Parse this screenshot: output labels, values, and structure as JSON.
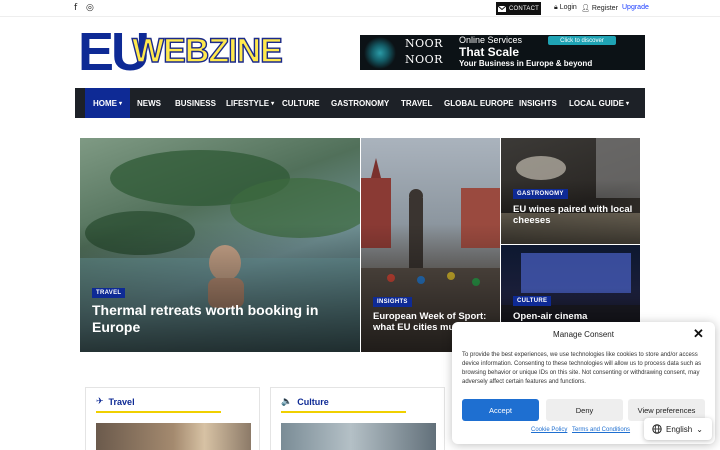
{
  "topbar": {
    "facebook_glyph": "f",
    "instagram_glyph": "◎",
    "contact_label": "CONTACT",
    "login_label": "Login",
    "register_label": "Register",
    "upgrade_label": "Upgrade"
  },
  "logo": {
    "part1": "EU",
    "part2": "WEBZINE"
  },
  "ad": {
    "brand_line1": "NOOR",
    "brand_line2": "NOOR",
    "line1": "Online Services",
    "line2": "That Scale",
    "line3": "Your Business in Europe & beyond",
    "cta": "Click to discover"
  },
  "nav": {
    "items": [
      {
        "label": "HOME",
        "caret": "▾"
      },
      {
        "label": "NEWS"
      },
      {
        "label": "BUSINESS"
      },
      {
        "label": "LIFESTYLE",
        "caret": "▾"
      },
      {
        "label": "CULTURE"
      },
      {
        "label": "GASTRONOMY"
      },
      {
        "label": "TRAVEL"
      },
      {
        "label": "GLOBAL EUROPE"
      },
      {
        "label": "INSIGHTS"
      },
      {
        "label": "LOCAL GUIDE",
        "caret": "▾"
      }
    ]
  },
  "hero": {
    "main": {
      "category": "TRAVEL",
      "title": "Thermal retreats worth booking in Europe"
    },
    "middle": {
      "category": "INSIGHTS",
      "title": "European Week of Sport: what EU cities mu"
    },
    "top_right": {
      "category": "GASTRONOMY",
      "title": "EU wines paired with local cheeses"
    },
    "bottom_right": {
      "category": "CULTURE",
      "title": "Open-air cinema"
    }
  },
  "cards": [
    {
      "title": "Travel",
      "icon": "✈"
    },
    {
      "title": "Culture",
      "icon": "🔈"
    }
  ],
  "consent": {
    "title": "Manage Consent",
    "close": "✕",
    "body": "To provide the best experiences, we use technologies like cookies to store and/or access device information. Consenting to these technologies will allow us to process data such as browsing behavior or unique IDs on this site. Not consenting or withdrawing consent, may adversely affect certain features and functions.",
    "accept": "Accept",
    "deny": "Deny",
    "preferences": "View preferences",
    "cookie_policy": "Cookie Policy",
    "terms": "Terms and Conditions"
  },
  "language": {
    "label": "English",
    "icon": "globe-icon",
    "caret": "⌄"
  },
  "colors": {
    "brand_blue": "#0e2a95",
    "accent_yellow": "#f0d000",
    "nav_bg": "#1d2127",
    "accept_blue": "#1e6fd1"
  }
}
